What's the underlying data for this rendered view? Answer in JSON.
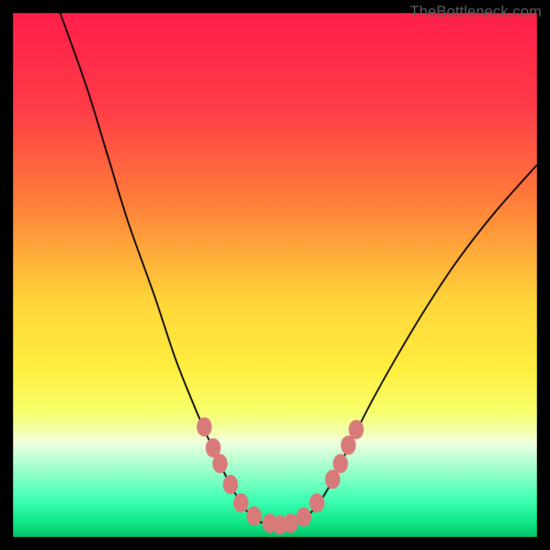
{
  "watermark": "TheBottleneck.com",
  "colors": {
    "gradient_stops": [
      {
        "offset": 0,
        "color": "#ff1f4a"
      },
      {
        "offset": 18,
        "color": "#ff3b48"
      },
      {
        "offset": 35,
        "color": "#ff7a3a"
      },
      {
        "offset": 55,
        "color": "#ffd53a"
      },
      {
        "offset": 68,
        "color": "#ffee3f"
      },
      {
        "offset": 76,
        "color": "#f7ff6a"
      },
      {
        "offset": 80,
        "color": "#f3ffb0"
      },
      {
        "offset": 82,
        "color": "#f0ffe0"
      },
      {
        "offset": 93,
        "color": "#3dffb3"
      },
      {
        "offset": 97,
        "color": "#13e989"
      },
      {
        "offset": 100,
        "color": "#00c46a"
      }
    ],
    "curve": "#000000",
    "marker_fill": "#d97a7a",
    "marker_stroke": "#d97a7a",
    "frame": "#000000"
  },
  "chart_data": {
    "type": "line",
    "title": "",
    "xlabel": "",
    "ylabel": "",
    "xlim": [
      0,
      100
    ],
    "ylim": [
      0,
      100
    ],
    "note": "Values are approximate, read from pixel positions. y=100 is top, y=0 is bottom. A V-shaped bottleneck curve on a heat gradient background.",
    "series": [
      {
        "name": "bottleneck-curve",
        "points": [
          {
            "x": 9,
            "y": 100
          },
          {
            "x": 14,
            "y": 86
          },
          {
            "x": 18,
            "y": 73
          },
          {
            "x": 22,
            "y": 60
          },
          {
            "x": 27,
            "y": 46
          },
          {
            "x": 31,
            "y": 34
          },
          {
            "x": 35,
            "y": 24
          },
          {
            "x": 39,
            "y": 15
          },
          {
            "x": 42,
            "y": 9
          },
          {
            "x": 45,
            "y": 4.5
          },
          {
            "x": 48,
            "y": 2.5
          },
          {
            "x": 51,
            "y": 2.2
          },
          {
            "x": 54,
            "y": 2.6
          },
          {
            "x": 57,
            "y": 4.8
          },
          {
            "x": 60,
            "y": 9
          },
          {
            "x": 64,
            "y": 17
          },
          {
            "x": 68,
            "y": 25
          },
          {
            "x": 73,
            "y": 34
          },
          {
            "x": 79,
            "y": 44
          },
          {
            "x": 85,
            "y": 53
          },
          {
            "x": 92,
            "y": 62
          },
          {
            "x": 100,
            "y": 71
          }
        ]
      }
    ],
    "markers": {
      "name": "highlighted-points",
      "shape": "ellipse",
      "points": [
        {
          "x": 36.5,
          "y": 21
        },
        {
          "x": 38.2,
          "y": 17
        },
        {
          "x": 39.5,
          "y": 14
        },
        {
          "x": 41.5,
          "y": 10
        },
        {
          "x": 43.5,
          "y": 6.5
        },
        {
          "x": 46,
          "y": 4
        },
        {
          "x": 49,
          "y": 2.6
        },
        {
          "x": 51,
          "y": 2.3
        },
        {
          "x": 53,
          "y": 2.6
        },
        {
          "x": 55.5,
          "y": 3.8
        },
        {
          "x": 58,
          "y": 6.5
        },
        {
          "x": 61,
          "y": 11
        },
        {
          "x": 62.5,
          "y": 14
        },
        {
          "x": 64,
          "y": 17.5
        },
        {
          "x": 65.5,
          "y": 20.5
        }
      ]
    }
  }
}
